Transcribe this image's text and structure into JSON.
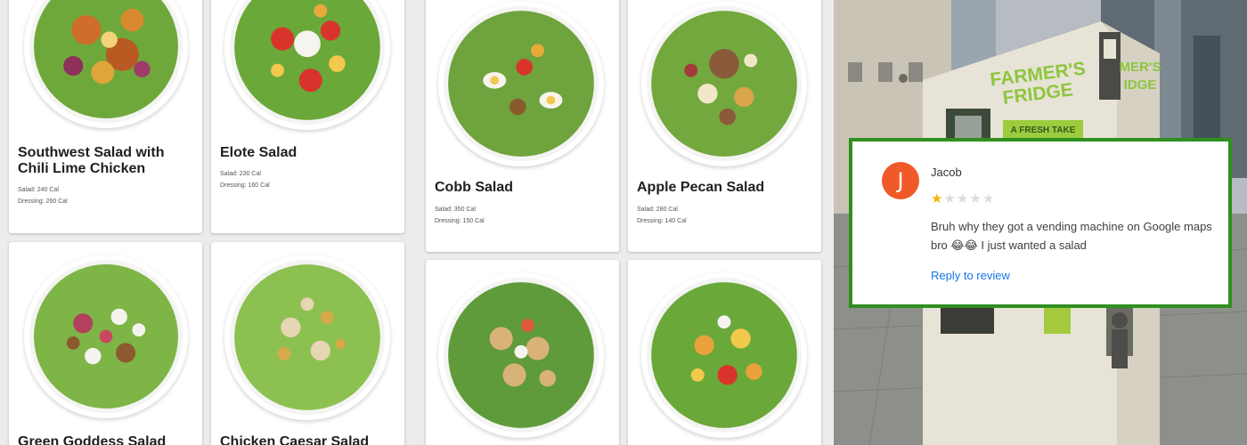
{
  "menu": {
    "cards": [
      {
        "id": "southwest",
        "title": "Southwest Salad with Chili Lime Chicken",
        "salad_cal": "Salad: 240 Cal",
        "dressing_cal": "Dressing: 260 Cal"
      },
      {
        "id": "elote",
        "title": "Elote Salad",
        "salad_cal": "Salad: 230 Cal",
        "dressing_cal": "Dressing: 160 Cal"
      },
      {
        "id": "cobb",
        "title": "Cobb Salad",
        "salad_cal": "Salad: 350 Cal",
        "dressing_cal": "Dressing: 150 Cal"
      },
      {
        "id": "apple-pecan",
        "title": "Apple Pecan Salad",
        "salad_cal": "Salad: 280 Cal",
        "dressing_cal": "Dressing: 140 Cal"
      },
      {
        "id": "green-goddess",
        "title": "Green Goddess Salad"
      },
      {
        "id": "chicken-caesar",
        "title": "Chicken Caesar Salad"
      },
      {
        "id": "pasta",
        "title": ""
      },
      {
        "id": "southwest-2",
        "title": ""
      }
    ]
  },
  "photo": {
    "kiosk_brand_line1": "FARMER'S",
    "kiosk_brand_line2": "FRIDGE",
    "kiosk_side_brand_line1": "MER'S",
    "kiosk_side_brand_line2": "IDGE",
    "kiosk_banner": "A FRESH TAKE"
  },
  "review": {
    "avatar_letter": "J",
    "avatar_color": "#f05a28",
    "reviewer_name": "Jacob",
    "rating": 1,
    "max_rating": 5,
    "text": "Bruh why they got a vending machine on Google maps bro 😂😂 I just wanted a salad",
    "reply_label": "Reply to review",
    "border_color": "#2f8f1f",
    "star_color": "#f4b400"
  }
}
